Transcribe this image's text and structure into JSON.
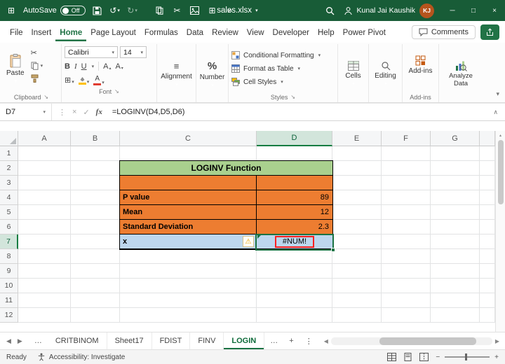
{
  "colors": {
    "titlebar_green": "#185C37",
    "accent_green": "#1A7243",
    "table_orange": "#ED7D31",
    "table_header_green": "#A9D08E",
    "highlight_blue": "#BDD7EE",
    "error_red": "#FF2020",
    "avatar_orange": "#B5541D"
  },
  "icons": {
    "app_grid": "⊞",
    "dropdown": "▾",
    "dropdown_up": "▴",
    "undo": "↺",
    "redo": "↻",
    "cut": "✂",
    "overflow": "»",
    "minimize": "─",
    "maximize": "□",
    "close": "×",
    "dots": "⋮",
    "cancel": "×",
    "check": "✓",
    "expand_up": "∧",
    "align": "≡",
    "percent": "%",
    "borders": "⊞",
    "font_a": "A",
    "launcher": "↘",
    "warning": "⚠",
    "nav_left": "◀",
    "nav_right": "▶",
    "ellipsis": "…",
    "add_sheet": "+",
    "zoom_out": "−",
    "zoom_in": "+"
  },
  "titlebar": {
    "autosave_label": "AutoSave",
    "autosave_state": "Off",
    "filename": "sales.xlsx",
    "user_name": "Kunal Jai Kaushik",
    "user_initials": "KJ"
  },
  "menubar": {
    "tabs": [
      "File",
      "Insert",
      "Home",
      "Page Layout",
      "Formulas",
      "Data",
      "Review",
      "View",
      "Developer",
      "Help",
      "Power Pivot"
    ],
    "active_tab": "Home",
    "comments_label": "Comments"
  },
  "ribbon": {
    "paste": "Paste",
    "clipboard_group": "Clipboard",
    "font_name": "Calibri",
    "font_size": "14",
    "bold": "B",
    "italic": "I",
    "underline": "U",
    "font_group": "Font",
    "alignment": "Alignment",
    "number": "Number",
    "conditional_formatting": "Conditional Formatting",
    "format_as_table": "Format as Table",
    "cell_styles": "Cell Styles",
    "styles_group": "Styles",
    "cells": "Cells",
    "editing": "Editing",
    "addins": "Add-ins",
    "addins_group": "Add-ins",
    "analyze_data": "Analyze Data"
  },
  "formula_bar": {
    "name_box": "D7",
    "fx": "fx",
    "formula": "=LOGINV(D4,D5,D6)"
  },
  "grid": {
    "columns": [
      "A",
      "B",
      "C",
      "D",
      "E",
      "F",
      "G"
    ],
    "rows": [
      "1",
      "2",
      "3",
      "4",
      "5",
      "6",
      "7",
      "8",
      "9",
      "10",
      "11",
      "12"
    ],
    "active_cell": "D7"
  },
  "table": {
    "title": "LOGINV Function",
    "p_label": "P value",
    "p_value": "89",
    "mean_label": "Mean",
    "mean_value": "12",
    "sd_label": "Standard Deviation",
    "sd_value": "2.3",
    "x_label": "x",
    "x_value": "#NUM!"
  },
  "sheet_tabs": {
    "tabs": [
      "CRITBINOM",
      "Sheet17",
      "FDIST",
      "FINV",
      "LOGIN"
    ],
    "active_tab": "LOGIN"
  },
  "status_bar": {
    "ready": "Ready",
    "accessibility": "Accessibility: Investigate"
  }
}
